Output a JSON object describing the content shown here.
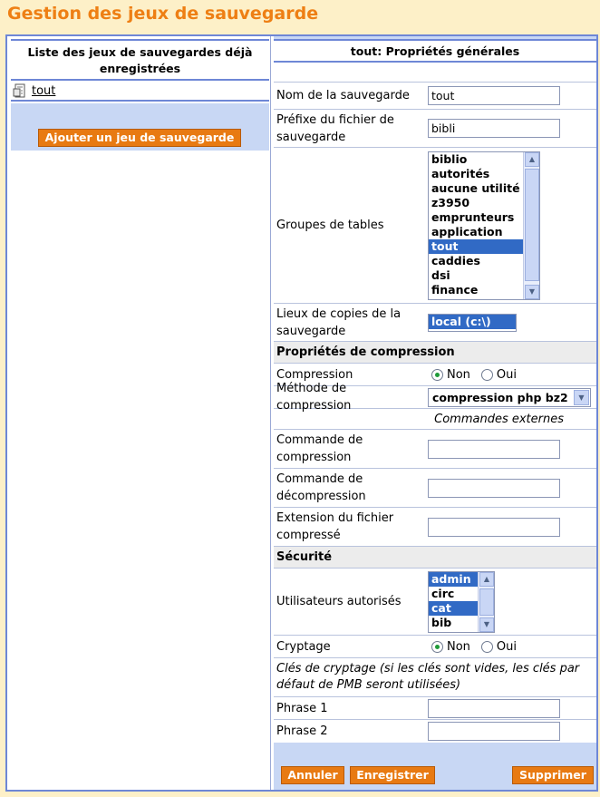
{
  "page": {
    "title": "Gestion des jeux de sauvegarde"
  },
  "left": {
    "header": "Liste des jeux de sauvegardes déjà enregistrées",
    "items": [
      {
        "label": "tout",
        "icon": "backup-file-icon"
      }
    ],
    "add_button": "Ajouter un jeu de sauvegarde"
  },
  "form": {
    "title": "tout: Propriétés générales",
    "name": {
      "label": "Nom de la sauvegarde",
      "value": "tout"
    },
    "prefix": {
      "label": "Préfixe du fichier de sauvegarde",
      "value": "bibli"
    },
    "table_groups": {
      "label": "Groupes de tables",
      "options": [
        "biblio",
        "autorités",
        "aucune utilité",
        "z3950",
        "emprunteurs",
        "application",
        "tout",
        "caddies",
        "dsi",
        "finance"
      ],
      "selected": [
        "tout"
      ]
    },
    "copy_locations": {
      "label": "Lieux de copies de la sauvegarde",
      "options": [
        "local (c:\\)"
      ],
      "selected": [
        "local (c:\\)"
      ]
    },
    "compression_section": "Propriétés de compression",
    "compression": {
      "label": "Compression",
      "options": [
        "Non",
        "Oui"
      ],
      "selected": "Non"
    },
    "compression_method": {
      "label": "Méthode de compression",
      "value": "compression php bz2"
    },
    "external_commands": "Commandes externes",
    "compress_cmd": {
      "label": "Commande de compression",
      "value": ""
    },
    "decompress_cmd": {
      "label": "Commande de décompression",
      "value": ""
    },
    "extension": {
      "label": "Extension du fichier compressé",
      "value": ""
    },
    "security_section": "Sécurité",
    "users": {
      "label": "Utilisateurs autorisés",
      "options": [
        "admin",
        "circ",
        "cat",
        "bib"
      ],
      "selected": [
        "admin",
        "cat"
      ]
    },
    "encryption": {
      "label": "Cryptage",
      "options": [
        "Non",
        "Oui"
      ],
      "selected": "Non"
    },
    "keys_note": "Clés de cryptage (si les clés sont vides, les clés par défaut de PMB seront utilisées)",
    "phrase1": {
      "label": "Phrase 1",
      "value": ""
    },
    "phrase2": {
      "label": "Phrase 2",
      "value": ""
    }
  },
  "buttons": {
    "cancel": "Annuler",
    "save": "Enregistrer",
    "delete": "Supprimer"
  },
  "colors": {
    "title": "#ee7f14",
    "button": "#e87a12",
    "border": "#6e87d6",
    "band": "#c8d7f4",
    "selection": "#316ac5"
  }
}
